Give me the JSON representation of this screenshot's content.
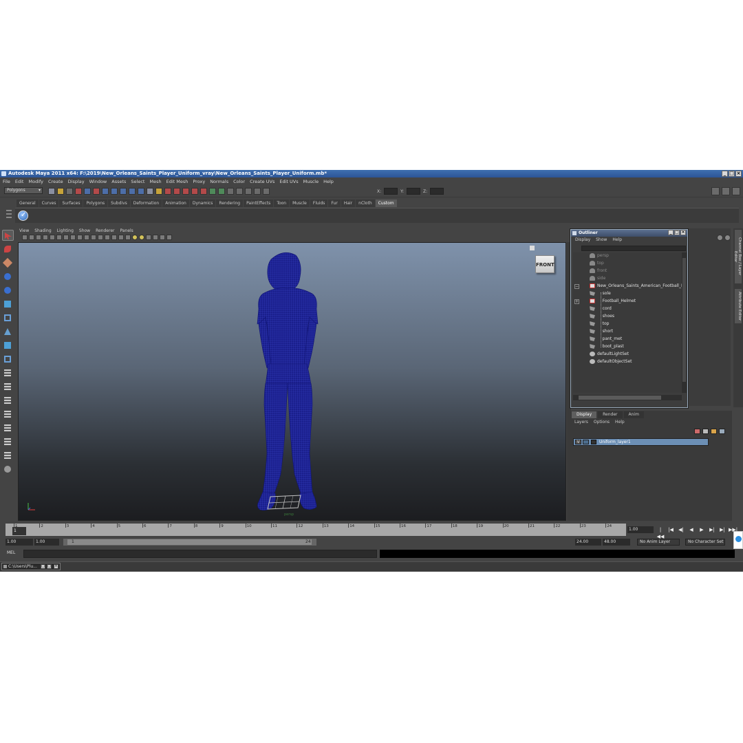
{
  "window": {
    "title": "Autodesk Maya 2011 x64: F:\\2019\\New_Orleans_Saints_Player_Uniform_vray\\New_Orleans_Saints_Player_Uniform.mb*"
  },
  "menubar": [
    "File",
    "Edit",
    "Modify",
    "Create",
    "Display",
    "Window",
    "Assets",
    "Select",
    "Mesh",
    "Edit Mesh",
    "Proxy",
    "Normals",
    "Color",
    "Create UVs",
    "Edit UVs",
    "Muscle",
    "Help"
  ],
  "statusline": {
    "mode": "Polygons",
    "x_label": "X:",
    "y_label": "Y:",
    "z_label": "Z:"
  },
  "shelf": {
    "tabs": [
      "General",
      "Curves",
      "Surfaces",
      "Polygons",
      "Subdivs",
      "Deformation",
      "Animation",
      "Dynamics",
      "Rendering",
      "PaintEffects",
      "Toon",
      "Muscle",
      "Fluids",
      "Fur",
      "Hair",
      "nCloth",
      "Custom"
    ],
    "active_tab": "Custom"
  },
  "viewport": {
    "menu": [
      "View",
      "Shading",
      "Lighting",
      "Show",
      "Renderer",
      "Panels"
    ],
    "viewcube_label": "FRONT",
    "camera_label": "persp",
    "wire_color": "#1a1f8c"
  },
  "outliner": {
    "title": "Outliner",
    "menu": [
      "Display",
      "Show",
      "Help"
    ],
    "items": [
      {
        "label": "persp",
        "icon": "camera-icon",
        "dim": true
      },
      {
        "label": "top",
        "icon": "camera-icon",
        "dim": true
      },
      {
        "label": "front",
        "icon": "camera-icon",
        "dim": true
      },
      {
        "label": "side",
        "icon": "camera-icon",
        "dim": true
      },
      {
        "label": "New_Orleans_Saints_American_Football_P",
        "icon": "group-icon",
        "dim": false
      },
      {
        "label": "sole",
        "icon": "mesh-icon",
        "dim": false
      },
      {
        "label": "Football_Helmet",
        "icon": "group-icon",
        "dim": false
      },
      {
        "label": "cord",
        "icon": "mesh-icon",
        "dim": false
      },
      {
        "label": "shoes",
        "icon": "mesh-icon",
        "dim": false
      },
      {
        "label": "top",
        "icon": "mesh-icon",
        "dim": false
      },
      {
        "label": "short",
        "icon": "mesh-icon",
        "dim": false
      },
      {
        "label": "pant_met",
        "icon": "mesh-icon",
        "dim": false
      },
      {
        "label": "boot_plast",
        "icon": "mesh-icon",
        "dim": false
      },
      {
        "label": "defaultLightSet",
        "icon": "set-icon",
        "dim": false
      },
      {
        "label": "defaultObjectSet",
        "icon": "set-icon",
        "dim": false
      }
    ]
  },
  "side_tabs": [
    "Channel Box / Layer Editor",
    "Attribute Editor"
  ],
  "layers": {
    "tabs": [
      "Display",
      "Render",
      "Anim"
    ],
    "active_tab": "Display",
    "menu": [
      "Layers",
      "Options",
      "Help"
    ],
    "rows": [
      {
        "visible": "V",
        "name": "Uniform_layer1"
      }
    ]
  },
  "timeline": {
    "ticks": [
      "1",
      "2",
      "3",
      "4",
      "5",
      "6",
      "7",
      "8",
      "9",
      "10",
      "11",
      "12",
      "13",
      "14",
      "15",
      "16",
      "17",
      "18",
      "19",
      "20",
      "21",
      "22",
      "23",
      "24"
    ],
    "current_frame": "1",
    "current_time": "1.00",
    "range_start": "1.00",
    "range_start_inner": "1.00",
    "slider_start": "1",
    "slider_end": "24",
    "range_end_inner": "24.00",
    "range_end": "48.00",
    "anim_layer": "No Anim Layer",
    "character_set": "No Character Set"
  },
  "command": {
    "label": "MEL"
  },
  "taskbar": {
    "item": "C:\\Users\\Plu..."
  }
}
